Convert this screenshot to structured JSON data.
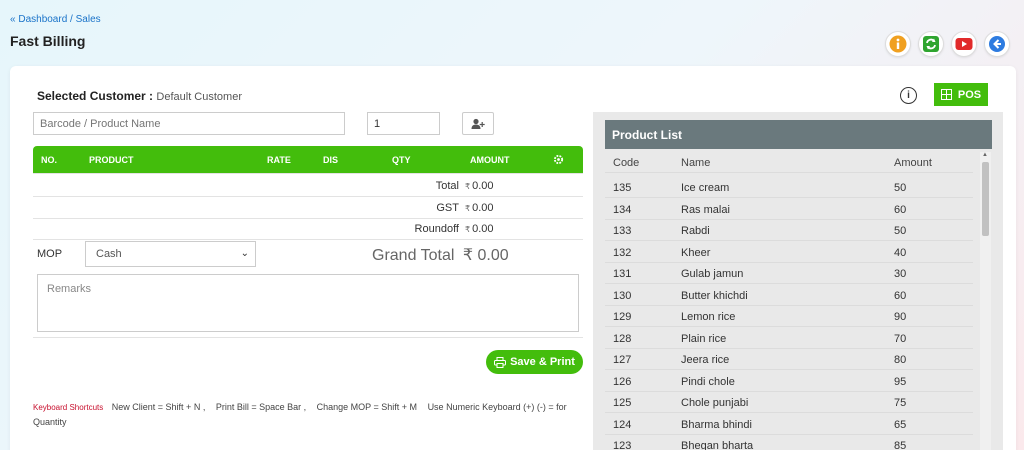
{
  "breadcrumb": {
    "prefix": "«",
    "dashboard": "Dashboard",
    "sep": "/",
    "sales": "Sales"
  },
  "page_title": "Fast Billing",
  "top_icons": [
    "info-icon",
    "refresh-icon",
    "youtube-icon",
    "back-icon"
  ],
  "colors": {
    "accent_green": "#43bd0c",
    "panel_header": "#6a797d",
    "link_blue": "#1a73c9",
    "shortcut_red": "#c8102e"
  },
  "customer": {
    "label": "Selected Customer",
    "colon": ":",
    "value": "Default Customer"
  },
  "search": {
    "placeholder": "Barcode / Product Name"
  },
  "quantity": {
    "value": "1"
  },
  "table": {
    "headers": {
      "no": "NO.",
      "product": "PRODUCT",
      "rate": "RATE",
      "dis": "DIS",
      "qty": "QTY",
      "amount": "AMOUNT"
    }
  },
  "totals": {
    "currency_small": "₹",
    "total_label": "Total",
    "total_value": "0.00",
    "gst_label": "GST",
    "gst_value": "0.00",
    "roundoff_label": "Roundoff",
    "roundoff_value": "0.00"
  },
  "mop": {
    "label": "MOP",
    "selected": "Cash"
  },
  "grand_total": {
    "label": "Grand Total",
    "value": "₹ 0.00"
  },
  "remarks": {
    "placeholder": "Remarks"
  },
  "save_button": {
    "label": "Save & Print"
  },
  "shortcuts": {
    "title": "Keyboard Shortcuts",
    "s1": "New Client = Shift + N ,",
    "s2": "Print Bill = Space Bar ,",
    "s3": "Change MOP = Shift + M",
    "s4": "Use Numeric Keyboard (+) (-) = for Quantity"
  },
  "pos_button": {
    "label": "POS"
  },
  "product_list": {
    "title": "Product List",
    "columns": {
      "code": "Code",
      "name": "Name",
      "amount": "Amount"
    },
    "rows": [
      {
        "code": "135",
        "name": "Ice cream",
        "amount": "50"
      },
      {
        "code": "134",
        "name": "Ras malai",
        "amount": "60"
      },
      {
        "code": "133",
        "name": "Rabdi",
        "amount": "50"
      },
      {
        "code": "132",
        "name": "Kheer",
        "amount": "40"
      },
      {
        "code": "131",
        "name": "Gulab jamun",
        "amount": "30"
      },
      {
        "code": "130",
        "name": "Butter khichdi",
        "amount": "60"
      },
      {
        "code": "129",
        "name": "Lemon rice",
        "amount": "90"
      },
      {
        "code": "128",
        "name": "Plain rice",
        "amount": "70"
      },
      {
        "code": "127",
        "name": "Jeera rice",
        "amount": "80"
      },
      {
        "code": "126",
        "name": "Pindi chole",
        "amount": "95"
      },
      {
        "code": "125",
        "name": "Chole punjabi",
        "amount": "75"
      },
      {
        "code": "124",
        "name": "Bharma bhindi",
        "amount": "65"
      },
      {
        "code": "123",
        "name": "Bhegan bharta",
        "amount": "85"
      }
    ]
  }
}
